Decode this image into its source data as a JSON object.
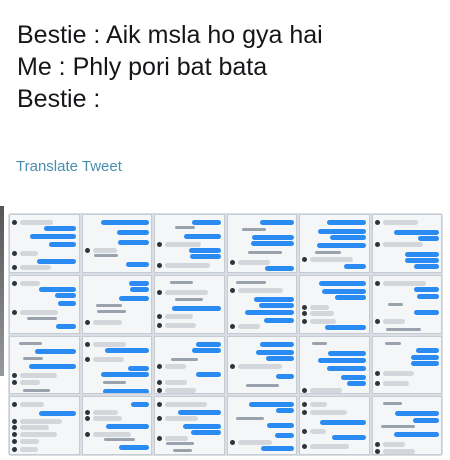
{
  "tweet": {
    "lines": [
      "Bestie : Aik msla ho gya hai",
      "Me : Phly pori bat bata",
      "Bestie :"
    ],
    "translate_label": "Translate Tweet"
  },
  "colors": {
    "text": "#14171a",
    "link": "#4a8fb0",
    "imessage_blue": "#2a8bf2"
  }
}
